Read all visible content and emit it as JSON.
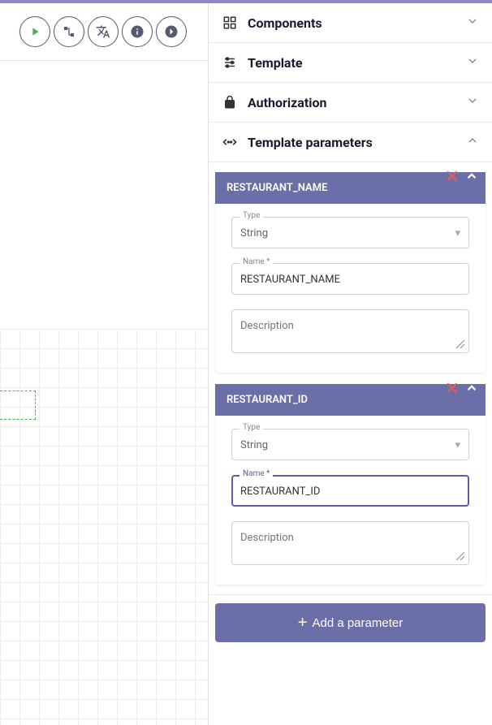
{
  "sections": {
    "components": {
      "label": "Components"
    },
    "template": {
      "label": "Template"
    },
    "authorization": {
      "label": "Authorization"
    },
    "template_params": {
      "label": "Template parameters"
    }
  },
  "params": [
    {
      "title": "RESTAURANT_NAME",
      "type_label": "Type",
      "type_value": "String",
      "name_label": "Name",
      "name_value": "RESTAURANT_NAME",
      "desc_placeholder": "Description",
      "desc_value": "",
      "focused": false
    },
    {
      "title": "RESTAURANT_ID",
      "type_label": "Type",
      "type_value": "String",
      "name_label": "Name",
      "name_value": "RESTAURANT_ID",
      "desc_placeholder": "Description",
      "desc_value": "",
      "focused": true
    }
  ],
  "add_button": {
    "label": "Add a parameter"
  }
}
